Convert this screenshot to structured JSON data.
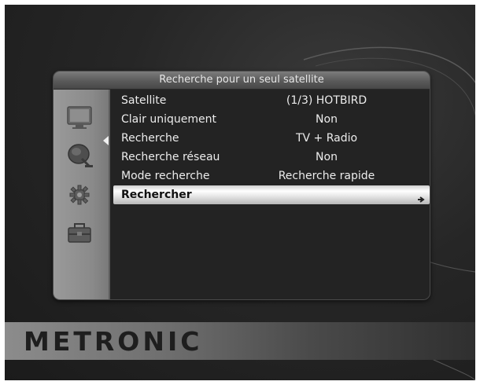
{
  "panel": {
    "title": "Recherche pour un seul satellite"
  },
  "sidebar": {
    "items": [
      {
        "icon": "tv-icon"
      },
      {
        "icon": "satellite-dish-icon",
        "active": true
      },
      {
        "icon": "settings-gear-icon"
      },
      {
        "icon": "toolbox-icon"
      }
    ]
  },
  "menu": {
    "rows": [
      {
        "label": "Satellite",
        "value": "(1/3) HOTBIRD"
      },
      {
        "label": "Clair uniquement",
        "value": "Non"
      },
      {
        "label": "Recherche",
        "value": "TV + Radio"
      },
      {
        "label": "Recherche réseau",
        "value": "Non"
      },
      {
        "label": "Mode recherche",
        "value": "Recherche rapide"
      },
      {
        "label": "Rechercher",
        "value": "",
        "selected": true
      }
    ]
  },
  "brand": {
    "name": "METRONIC"
  },
  "colors": {
    "background": "#262626",
    "selection": "#ffffff",
    "text": "#ececec"
  }
}
